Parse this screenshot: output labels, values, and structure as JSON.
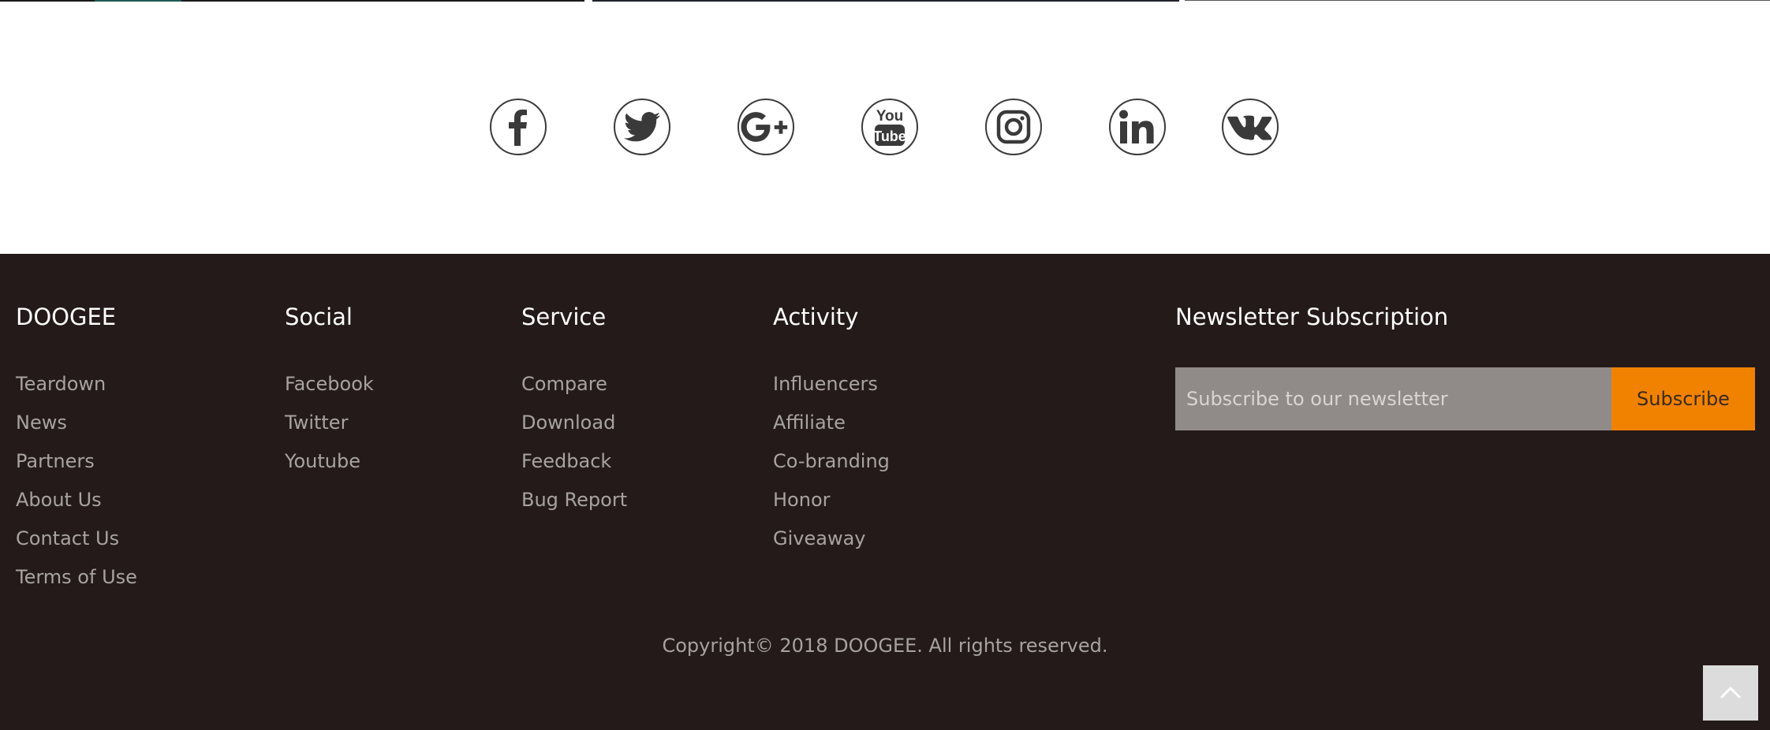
{
  "social": {
    "icons": [
      "facebook-icon",
      "twitter-icon",
      "google-plus-icon",
      "youtube-icon",
      "instagram-icon",
      "linkedin-icon",
      "vk-icon"
    ]
  },
  "footer": {
    "columns": [
      {
        "title": "DOOGEE",
        "links": [
          "Teardown",
          "News",
          "Partners",
          "About Us",
          "Contact Us",
          "Terms of Use"
        ]
      },
      {
        "title": "Social",
        "links": [
          "Facebook",
          "Twitter",
          "Youtube"
        ]
      },
      {
        "title": "Service",
        "links": [
          "Compare",
          "Download",
          "Feedback",
          "Bug Report"
        ]
      },
      {
        "title": "Activity",
        "links": [
          "Influencers",
          "Affiliate",
          "Co-branding",
          "Honor",
          "Giveaway"
        ]
      }
    ],
    "newsletter": {
      "title": "Newsletter Subscription",
      "placeholder": "Subscribe to our newsletter",
      "button_label": "Subscribe"
    },
    "copyright": "Copyright© 2018 DOOGEE. All rights reserved."
  },
  "colors": {
    "footer_bg": "#241a19",
    "accent": "#f08200",
    "link_text": "#a7a3a2"
  }
}
